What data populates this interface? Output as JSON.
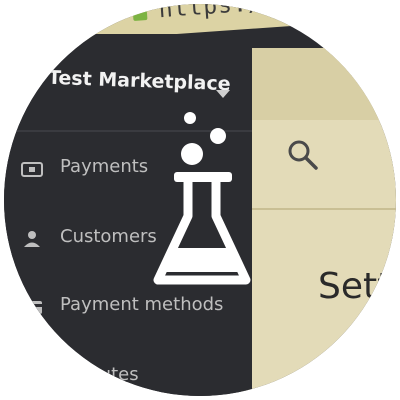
{
  "browser": {
    "url_visible": "https://dashboa"
  },
  "sidebar": {
    "account_name": "Test Marketplace",
    "items": [
      {
        "label": "Payments",
        "icon": "wallet-icon"
      },
      {
        "label": "Customers",
        "icon": "person-icon"
      },
      {
        "label": "Payment methods",
        "icon": "card-icon"
      },
      {
        "label": "Disputes",
        "icon": "dispute-icon"
      }
    ]
  },
  "main": {
    "title_partial": "Sett",
    "search_icon": "search-icon"
  },
  "overlay": {
    "icon": "flask-icon"
  },
  "colors": {
    "sidebar": "#2b2c30",
    "content": "#e3dbb8",
    "url_bar": "#dcd3a4",
    "overlay": "#ffffff"
  }
}
